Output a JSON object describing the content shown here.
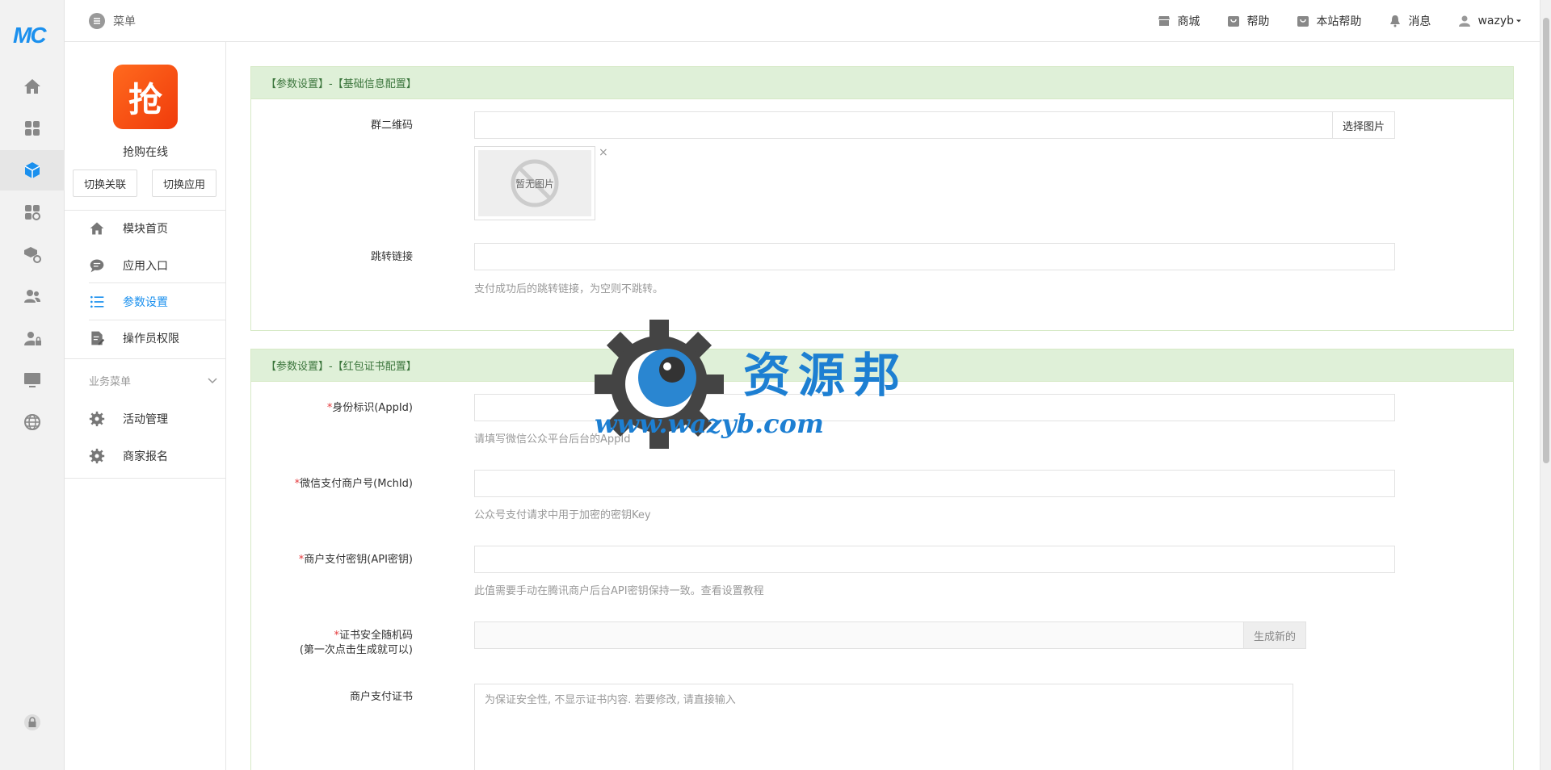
{
  "rail": {
    "logo": "MC",
    "icons": [
      "home-icon",
      "apps-grid-icon",
      "cube-icon",
      "apps-gear-icon",
      "package-gear-icon",
      "users-icon",
      "user-lock-icon",
      "monitor-icon",
      "globe-icon",
      "lock-icon"
    ]
  },
  "topbar": {
    "menu_label": "菜单",
    "nav": [
      {
        "label": "商城",
        "icon": "store-icon"
      },
      {
        "label": "帮助",
        "icon": "bag-icon"
      },
      {
        "label": "本站帮助",
        "icon": "bag-icon"
      },
      {
        "label": "消息",
        "icon": "bell-icon"
      },
      {
        "label": "wazyb",
        "icon": "user-icon"
      }
    ]
  },
  "sidebar": {
    "app_logo_char": "抢",
    "app_name": "抢购在线",
    "switch_link": "切换关联",
    "switch_app": "切换应用",
    "items": [
      {
        "label": "模块首页",
        "icon": "home-icon"
      },
      {
        "label": "应用入口",
        "icon": "chat-icon"
      },
      {
        "label": "参数设置",
        "icon": "list-icon",
        "active": true
      },
      {
        "label": "操作员权限",
        "icon": "edit-doc-icon"
      }
    ],
    "section_title": "业务菜单",
    "business_items": [
      {
        "label": "活动管理",
        "icon": "gear-icon"
      },
      {
        "label": "商家报名",
        "icon": "gear-icon"
      }
    ]
  },
  "panel1": {
    "title": "【参数设置】-【基础信息配置】",
    "qrcode_label": "群二维码",
    "qrcode_value": "",
    "choose_image": "选择图片",
    "no_image": "暂无图片",
    "close_mark": "×",
    "redirect_label": "跳转链接",
    "redirect_value": "",
    "redirect_help": "支付成功后的跳转链接，为空则不跳转。"
  },
  "panel2": {
    "title": "【参数设置】-【红包证书配置】",
    "appid_label": "身份标识(AppId)",
    "appid_help": "请填写微信公众平台后台的AppId",
    "mchid_label": "微信支付商户号(MchId)",
    "mchid_help": "公众号支付请求中用于加密的密钥Key",
    "apikey_label": "商户支付密钥(API密钥)",
    "apikey_help": "此值需要手动在腾讯商户后台API密钥保持一致。查看设置教程",
    "random_label": "证书安全随机码",
    "random_sub": "(第一次点击生成就可以)",
    "random_button": "生成新的",
    "cert_label": "商户支付证书",
    "cert_placeholder": "为保证安全性, 不显示证书内容. 若要修改, 请直接输入",
    "required_mark": "*"
  },
  "watermark": {
    "title": "资源邦",
    "url": "www.wazyb.com"
  },
  "colors": {
    "accent": "#1b90ee",
    "panel_head_bg": "#dff0d8",
    "panel_head_text": "#3c763d",
    "required": "#e4393c"
  }
}
